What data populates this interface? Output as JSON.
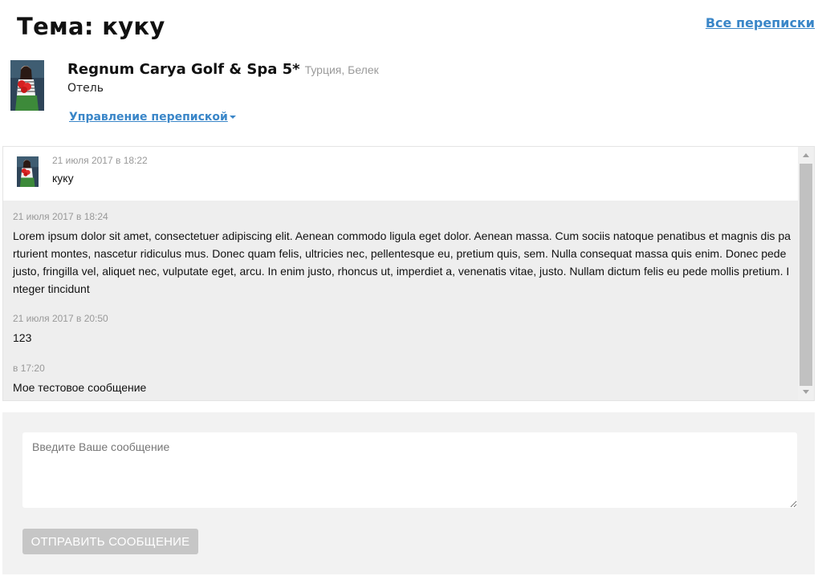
{
  "header": {
    "title": "Тема: куку",
    "all_link": "Все переписки"
  },
  "hotel": {
    "name": "Regnum Carya Golf & Spa 5*",
    "location": "Турция, Белек",
    "type": "Отель",
    "manage_label": "Управление перепиской"
  },
  "messages": [
    {
      "date": "21 июля 2017 в 18:22",
      "text": "куку"
    },
    {
      "date": "21 июля 2017 в 18:24",
      "text": "Lorem ipsum dolor sit amet, consectetuer adipiscing elit. Aenean commodo ligula eget dolor. Aenean massa. Cum sociis natoque penatibus et magnis dis parturient montes, nascetur ridiculus mus. Donec quam felis, ultricies nec, pellentesque eu, pretium quis, sem. Nulla consequat massa quis enim. Donec pede justo, fringilla vel, aliquet nec, vulputate eget, arcu. In enim justo, rhoncus ut, imperdiet a, venenatis vitae, justo. Nullam dictum felis eu pede mollis pretium. Integer tincidunt"
    },
    {
      "date": "21 июля 2017 в 20:50",
      "text": "123"
    },
    {
      "date": "в 17:20",
      "text": "Мое тестовое сообщение"
    }
  ],
  "compose": {
    "placeholder": "Введите Ваше сообщение",
    "send_label": "ОТПРАВИТЬ СООБЩЕНИЕ"
  },
  "colors": {
    "link": "#3a86c8",
    "incoming_bg": "#eeeeee",
    "compose_bg": "#f2f2f2",
    "button_disabled": "#c6c6c6"
  }
}
